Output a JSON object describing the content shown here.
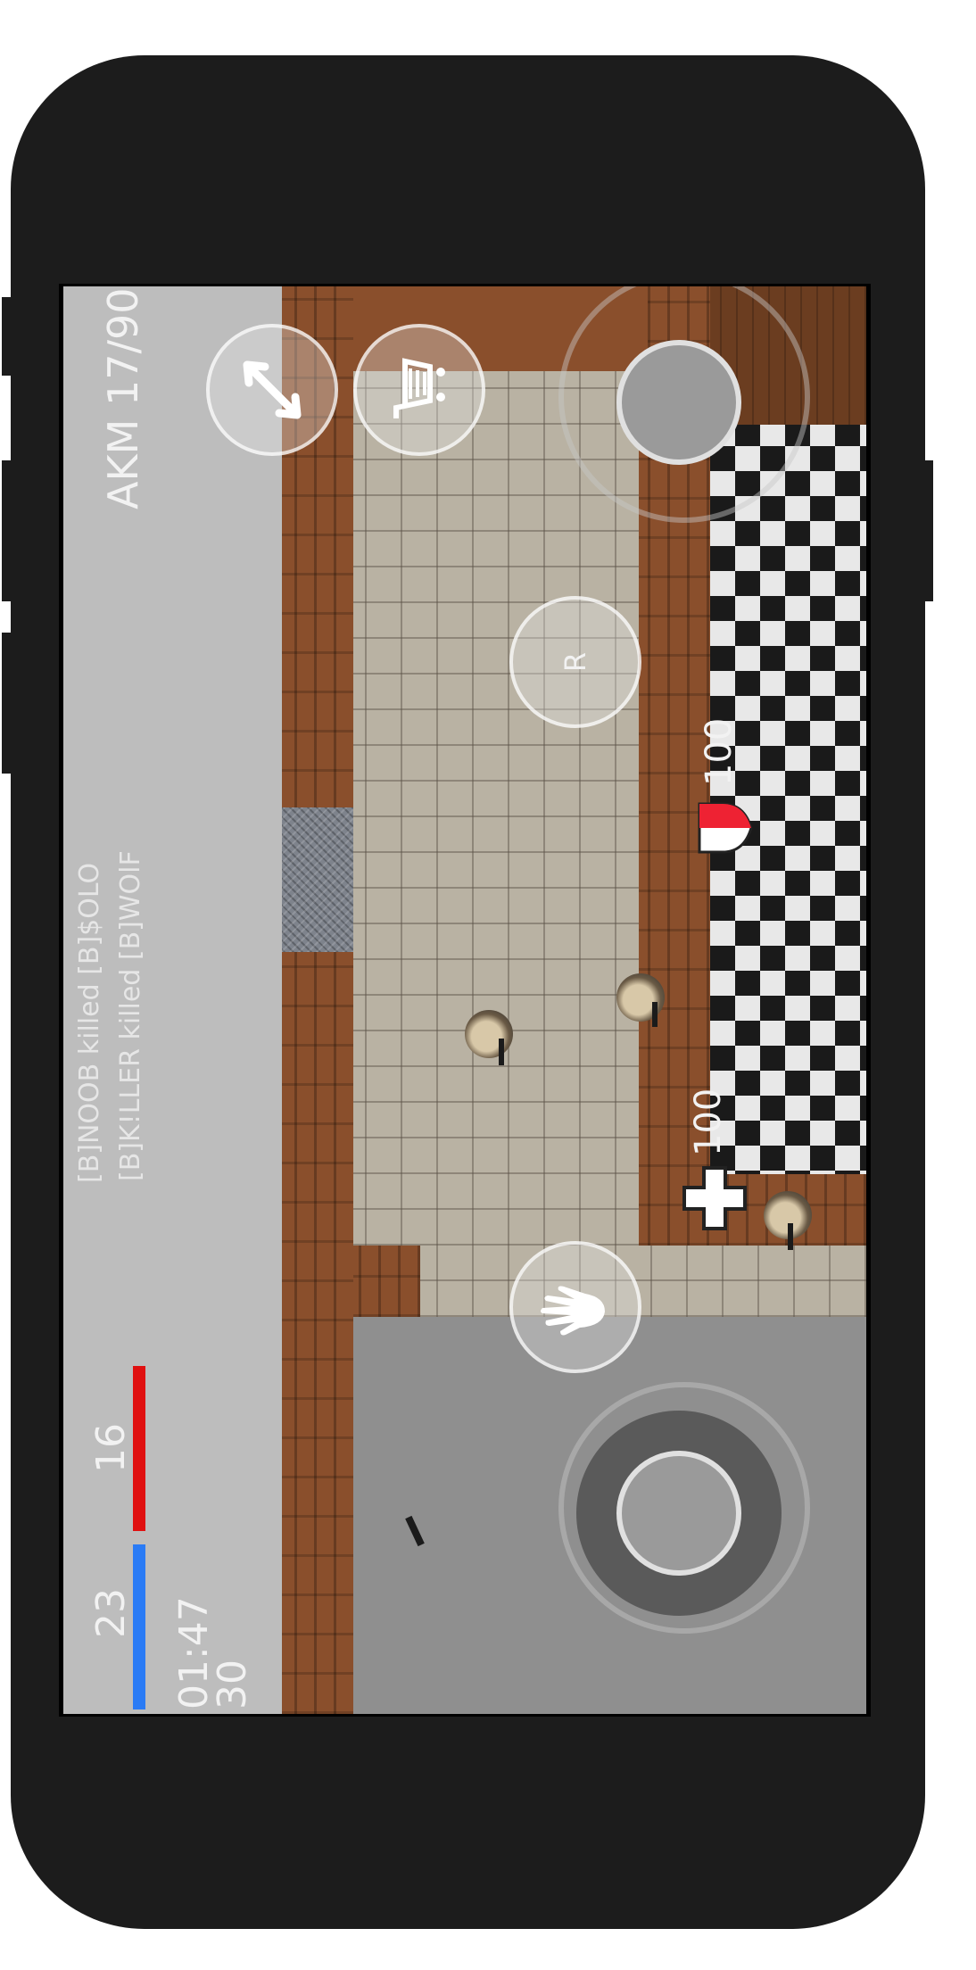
{
  "hud": {
    "team_blue_score": "23",
    "team_red_score": "16",
    "timer": "01:47",
    "secondary_count": "30",
    "weapon_ammo": "AKM 17/90",
    "reload_label": "R",
    "health_value": "100",
    "armor_value": "100"
  },
  "killfeed": [
    "[B]NOOB killed [B]$OLO",
    "[B]K!LLER killed [B]WOlF"
  ],
  "controls": {
    "move_joystick_icon": "move-joystick-icon",
    "aim_joystick_icon": "aim-joystick-icon",
    "pickup_icon": "hand-icon",
    "swap_icon": "swap-arrows-icon",
    "shop_icon": "shopping-cart-icon"
  },
  "colors": {
    "team_blue": "#2a7bf5",
    "team_red": "#e01010"
  }
}
